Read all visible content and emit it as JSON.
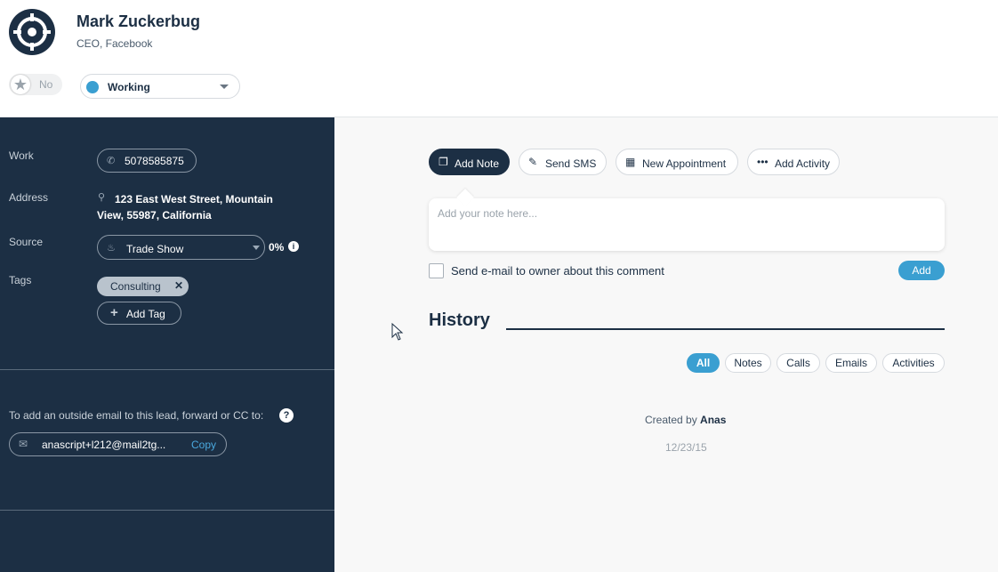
{
  "header": {
    "name": "Mark Zuckerbug",
    "title": "CEO, Facebook",
    "star_toggle_label": "No",
    "status": "Working",
    "colors": {
      "navy": "#1c2f44",
      "accent": "#3a9fd1"
    }
  },
  "sidebar": {
    "work_label": "Work",
    "phone": "5078585875",
    "address_label": "Address",
    "address": "123 East West Street, Mountain View, 55987, California",
    "source_label": "Source",
    "source": "Trade Show",
    "source_pct": "0%",
    "tags_label": "Tags",
    "tags": [
      "Consulting"
    ],
    "add_tag_label": "Add Tag",
    "email_hint": "To add an outside email to this lead, forward or CC to:",
    "email": "anascript+l212@mail2tg...",
    "copy_label": "Copy"
  },
  "main": {
    "actions": [
      {
        "label": "Add Note",
        "icon": "note-icon"
      },
      {
        "label": "Send SMS",
        "icon": "sms-icon"
      },
      {
        "label": "New Appointment",
        "icon": "calendar-icon"
      },
      {
        "label": "Add Activity",
        "icon": "more-icon"
      }
    ],
    "note_placeholder": "Add your note here...",
    "send_email_label": "Send e-mail to owner about this comment",
    "add_label": "Add",
    "history_title": "History",
    "filters": [
      "All",
      "Notes",
      "Calls",
      "Emails",
      "Activities"
    ],
    "created_prefix": "Created by",
    "created_by": "Anas",
    "created_date": "12/23/15"
  }
}
